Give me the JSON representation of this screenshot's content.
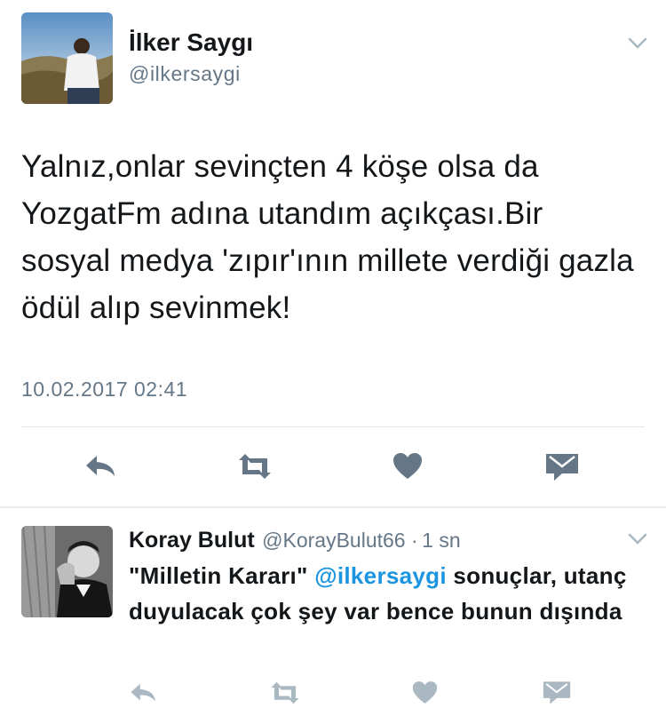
{
  "tweet": {
    "author_name": "İlker Saygı",
    "author_handle": "@ilkersaygi",
    "text": "Yalnız,onlar sevinçten 4 köşe olsa da YozgatFm adına utandım açıkçası.Bir sosyal medya 'zıpır'ının millete verdiği gazla ödül alıp sevinmek!",
    "timestamp": "10.02.2017 02:41",
    "actions": {
      "reply_icon": "reply-icon",
      "retweet_icon": "retweet-icon",
      "like_icon": "heart-icon",
      "dm_icon": "envelope-icon"
    }
  },
  "reply": {
    "author_name": "Koray Bulut",
    "author_handle": "@KorayBulut66",
    "separator": "·",
    "time": "1 sn",
    "text_quote": "\"Milletin Kararı\"",
    "text_mention": "@ilkersaygi",
    "text_rest": "sonuçlar, utanç duyulacak çok şey var bence bunun dışında"
  },
  "colors": {
    "text": "#14171a",
    "secondary": "#657786",
    "link": "#1b95e0",
    "icon": "#657786",
    "icon_light": "#aab8c2",
    "divider": "#e1e8ed"
  }
}
